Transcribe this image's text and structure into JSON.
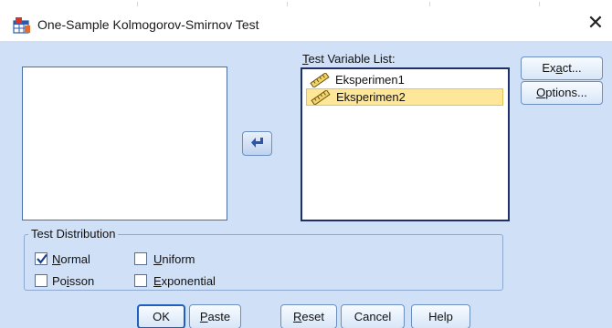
{
  "window": {
    "title": "One-Sample Kolmogorov-Smirnov Test",
    "close_glyph": "✕",
    "icon": "spss-dialog-icon"
  },
  "source_list": {
    "items": []
  },
  "move_button": {
    "icon": "arrow-left-icon"
  },
  "test_variable_list": {
    "label_key": "T",
    "label_rest": "est Variable List:",
    "items": [
      {
        "label": "Eksperimen1",
        "selected": false,
        "icon": "scale-ruler-icon"
      },
      {
        "label": "Eksperimen2",
        "selected": true,
        "icon": "scale-ruler-icon"
      }
    ]
  },
  "side_buttons": {
    "exact": {
      "pre": "Ex",
      "key": "a",
      "post": "ct..."
    },
    "options": {
      "pre": "",
      "key": "O",
      "post": "ptions..."
    }
  },
  "test_distribution": {
    "title": "Test Distribution",
    "normal": {
      "key": "N",
      "rest": "ormal",
      "checked": true
    },
    "uniform": {
      "key": "U",
      "rest": "niform",
      "checked": false
    },
    "poisson": {
      "pre": "Po",
      "key": "i",
      "rest": "sson",
      "checked": false
    },
    "exponential": {
      "key": "E",
      "rest": "xponential",
      "checked": false
    }
  },
  "bottom_buttons": {
    "ok": "OK",
    "paste": {
      "key": "P",
      "rest": "aste"
    },
    "reset": {
      "key": "R",
      "rest": "eset"
    },
    "cancel": "Cancel",
    "help": "Help"
  },
  "colors": {
    "dialog_background": "#cfe0f7",
    "selection": "#ffe79a",
    "default_button_border": "#1e5fbf"
  }
}
